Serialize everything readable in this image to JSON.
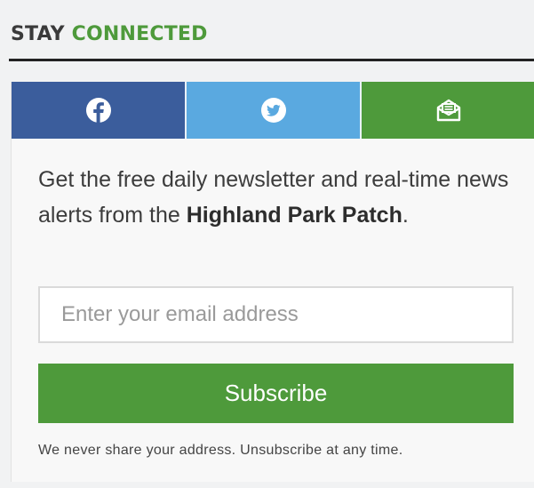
{
  "widget": {
    "heading_part1": "STAY ",
    "heading_part2": "CONNECTED"
  },
  "social": [
    {
      "name": "facebook",
      "icon": "facebook-icon",
      "color": "#3b5d9c"
    },
    {
      "name": "twitter",
      "icon": "twitter-icon",
      "color": "#5aa9e0"
    },
    {
      "name": "email",
      "icon": "envelope-icon",
      "color": "#4e9a3b"
    }
  ],
  "newsletter": {
    "text_before": "Get the free daily newsletter and real-time news alerts from the ",
    "highlight": "Highland Park Patch",
    "text_after": ".",
    "email_placeholder": "Enter your email address",
    "subscribe_label": "Subscribe",
    "disclaimer": "We never share your address. Unsubscribe at any time."
  },
  "colors": {
    "accent_green": "#4e9a3b",
    "facebook_blue": "#3b5d9c",
    "twitter_blue": "#5aa9e0"
  }
}
